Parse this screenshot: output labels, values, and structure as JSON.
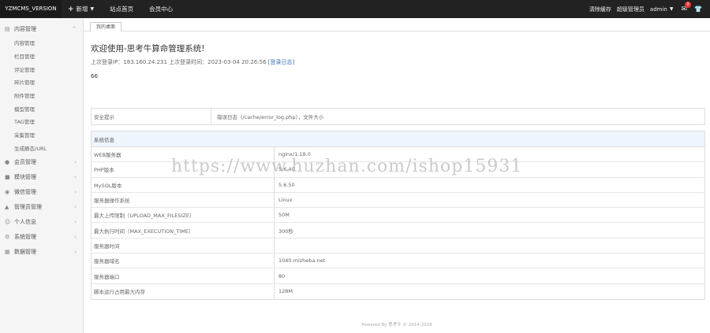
{
  "topbar": {
    "brand": "YZMCMS_VERSION",
    "nav": [
      {
        "label": "新增",
        "has_plus": true,
        "has_caret": true
      },
      {
        "label": "站点首页"
      },
      {
        "label": "会员中心"
      }
    ],
    "right": {
      "clear_cache": "清除缓存",
      "role": "超级管理员",
      "user": "admin",
      "mail_badge": "0"
    }
  },
  "sidebar": {
    "groups": [
      {
        "label": "内容管理",
        "icon": "document-icon",
        "arrow": "^",
        "items": [
          "内容管理",
          "栏目管理",
          "评论管理",
          "碎片管理",
          "附件管理",
          "模型管理",
          "TAG管理",
          "采集管理",
          "生成静态/URL"
        ]
      },
      {
        "label": "会员管理",
        "icon": "user-icon",
        "arrow": "<"
      },
      {
        "label": "模块管理",
        "icon": "module-icon",
        "arrow": "<"
      },
      {
        "label": "微信管理",
        "icon": "wechat-icon",
        "arrow": "<"
      },
      {
        "label": "管理员管理",
        "icon": "admin-icon",
        "arrow": "<"
      },
      {
        "label": "个人信息",
        "icon": "person-icon",
        "arrow": "<"
      },
      {
        "label": "系统管理",
        "icon": "gear-icon",
        "arrow": "<"
      },
      {
        "label": "数据管理",
        "icon": "database-icon",
        "arrow": "<"
      }
    ]
  },
  "main": {
    "tab": "我的桌面",
    "welcome": "欢迎使用-思考牛算命管理系统!",
    "last_login_text": "上次登录IP：183.160.24.231 上次登录时间：2023-03-04 20:26:56",
    "login_log_link": "[登录日志]",
    "number": "66",
    "security": {
      "label": "安全提示",
      "value": "错误日志（/cache/error_log.php），文件大小"
    },
    "system": {
      "title": "系统信息",
      "rows": [
        {
          "k": "WEB服务器",
          "v": "nginx/1.18.0"
        },
        {
          "k": "PHP版本",
          "v": "5.6.40"
        },
        {
          "k": "MySQL版本",
          "v": "5.6.50"
        },
        {
          "k": "服务器操作系统",
          "v": "Linux"
        },
        {
          "k": "最大上传限制（UPLOAD_MAX_FILESIZE）",
          "v": "50M"
        },
        {
          "k": "最大执行时间（MAX_EXECUTION_TIME）",
          "v": "300秒"
        },
        {
          "k": "服务器时间",
          "v": ""
        },
        {
          "k": "服务器域名",
          "v": "1040.mizheba.net"
        },
        {
          "k": "服务器端口",
          "v": "80"
        },
        {
          "k": "脚本运行占用最大内存",
          "v": "128M"
        }
      ]
    },
    "footer": "Powered By 思考牛 © 2014-2018"
  },
  "watermark": "https://www.huzhan.com/ishop15931"
}
